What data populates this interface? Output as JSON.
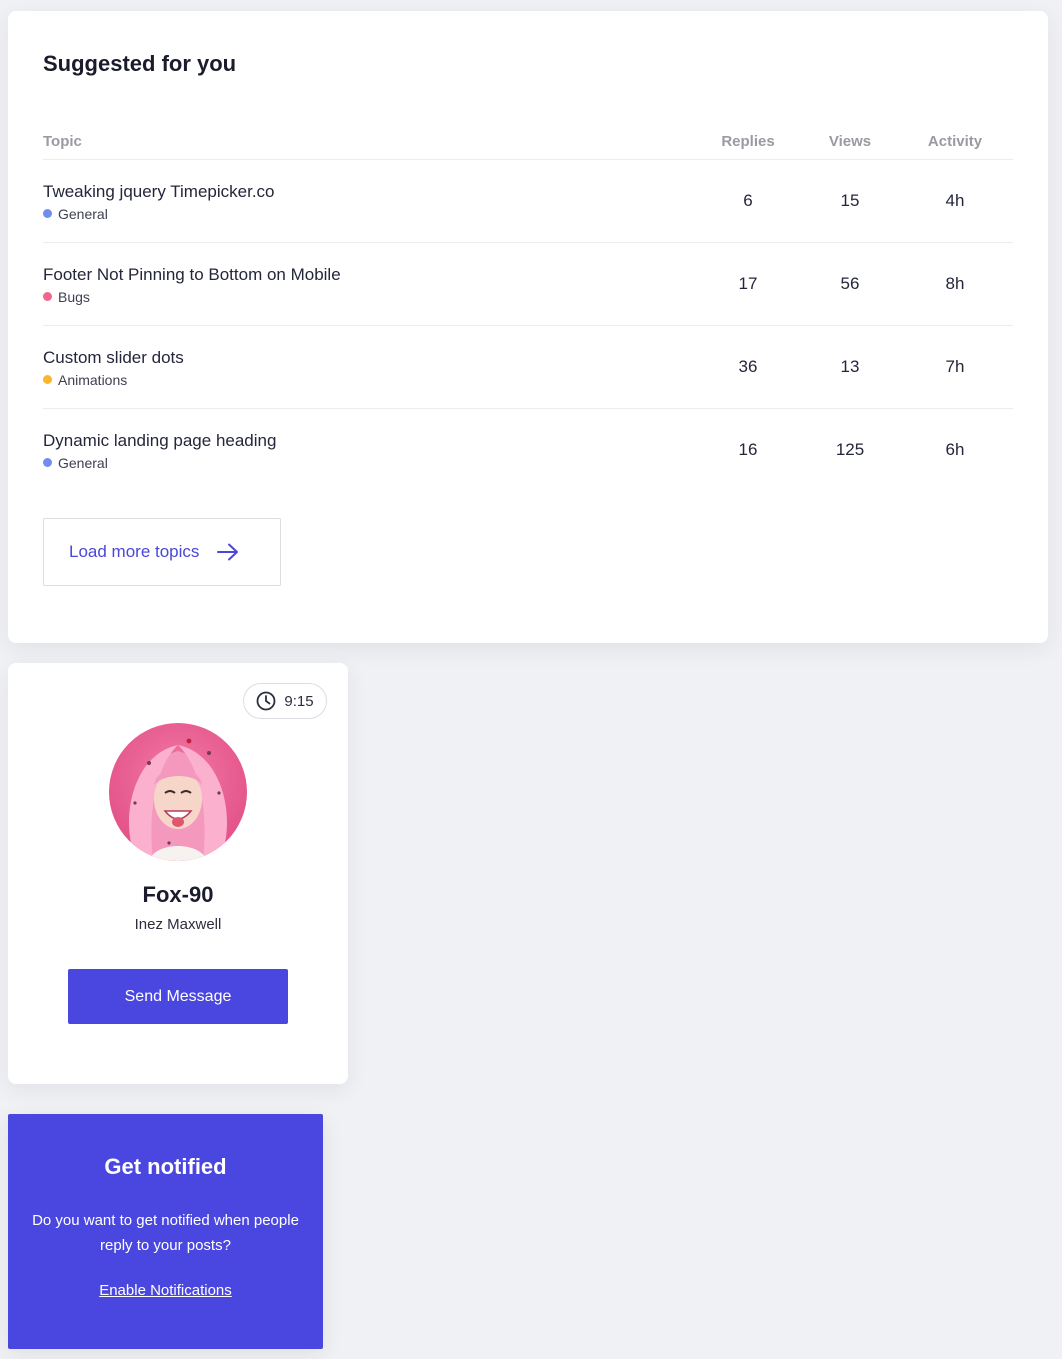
{
  "topics": {
    "title": "Suggested for you",
    "headers": {
      "topic": "Topic",
      "replies": "Replies",
      "views": "Views",
      "activity": "Activity"
    },
    "rows": [
      {
        "title": "Tweaking jquery Timepicker.co",
        "category": "General",
        "category_color": "#6f8ef0",
        "replies": "6",
        "views": "15",
        "activity": "4h"
      },
      {
        "title": "Footer Not Pinning to Bottom on Mobile",
        "category": "Bugs",
        "category_color": "#f2668b",
        "replies": "17",
        "views": "56",
        "activity": "8h"
      },
      {
        "title": "Custom slider dots",
        "category": "Animations",
        "category_color": "#f7b731",
        "replies": "36",
        "views": "13",
        "activity": "7h"
      },
      {
        "title": "Dynamic landing page heading",
        "category": "General",
        "category_color": "#6f8ef0",
        "replies": "16",
        "views": "125",
        "activity": "6h"
      }
    ],
    "load_more_label": "Load more topics",
    "load_more_icon": "arrow-right-icon"
  },
  "profile": {
    "time": "9:15",
    "time_icon": "clock-icon",
    "username": "Fox-90",
    "full_name": "Inez Maxwell",
    "send_label": "Send Message"
  },
  "notify": {
    "title": "Get notified",
    "text": "Do you want to get notified when people reply to your posts?",
    "link_label": "Enable Notifications"
  },
  "colors": {
    "accent": "#4a47e0",
    "page_bg": "#f0f1f4"
  }
}
